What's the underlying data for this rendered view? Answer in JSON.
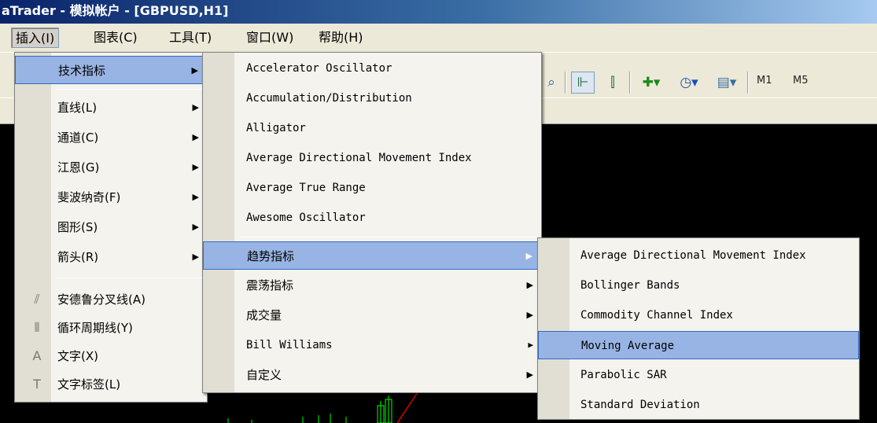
{
  "titlebar": {
    "text": "aTrader - 模拟帐户 - [GBPUSD,H1]"
  },
  "menubar": {
    "items": [
      {
        "label": "插入(I)",
        "active": true
      },
      {
        "label": "图表(C)",
        "active": false
      },
      {
        "label": "工具(T)",
        "active": false
      },
      {
        "label": "窗口(W)",
        "active": false
      },
      {
        "label": "帮助(H)",
        "active": false
      }
    ]
  },
  "toolbar": {
    "timeframes": [
      "M1",
      "M5"
    ],
    "icons": [
      "magnifier-icon",
      "chart-shift-icon",
      "autoscroll-icon",
      "add-indicator-icon",
      "clock-icon",
      "templates-icon"
    ]
  },
  "insert_menu": {
    "items": [
      {
        "label": "技术指标",
        "arrow": "▶",
        "highlighted": true
      },
      {
        "label": "直线(L)",
        "arrow": "▶"
      },
      {
        "label": "通道(C)",
        "arrow": "▶"
      },
      {
        "label": "江恩(G)",
        "arrow": "▶"
      },
      {
        "label": "斐波纳奇(F)",
        "arrow": "▶"
      },
      {
        "label": "图形(S)",
        "arrow": "▶"
      },
      {
        "label": "箭头(R)",
        "arrow": "▶"
      },
      {
        "label": "安德鲁分叉线(A)",
        "icon": "pitchfork-icon"
      },
      {
        "label": "循环周期线(Y)",
        "icon": "cycle-lines-icon"
      },
      {
        "label": "文字(X)",
        "icon": "text-icon"
      },
      {
        "label": "文字标签(L)",
        "icon": "text-label-icon"
      }
    ]
  },
  "indicators_menu": {
    "items": [
      {
        "label": "Accelerator Oscillator"
      },
      {
        "label": "Accumulation/Distribution"
      },
      {
        "label": "Alligator"
      },
      {
        "label": "Average Directional Movement Index"
      },
      {
        "label": "Average True Range"
      },
      {
        "label": "Awesome Oscillator"
      },
      {
        "label": "趋势指标",
        "arrow": "▶",
        "highlighted": true
      },
      {
        "label": "震荡指标",
        "arrow": "▶"
      },
      {
        "label": "成交量",
        "arrow": "▶"
      },
      {
        "label": "Bill Williams",
        "arrow": "▶"
      },
      {
        "label": "自定义",
        "arrow": "▶"
      }
    ]
  },
  "trend_menu": {
    "items": [
      {
        "label": "Average Directional Movement Index"
      },
      {
        "label": "Bollinger Bands"
      },
      {
        "label": "Commodity Channel Index"
      },
      {
        "label": "Moving Average",
        "highlighted": true
      },
      {
        "label": "Parabolic SAR"
      },
      {
        "label": "Standard Deviation"
      }
    ]
  },
  "colors": {
    "menu_bg": "#f4f3ee",
    "highlight": "#98b4e4",
    "chart_bg": "#000000",
    "candle": "#00ff00",
    "trend_line": "#ff0000"
  }
}
